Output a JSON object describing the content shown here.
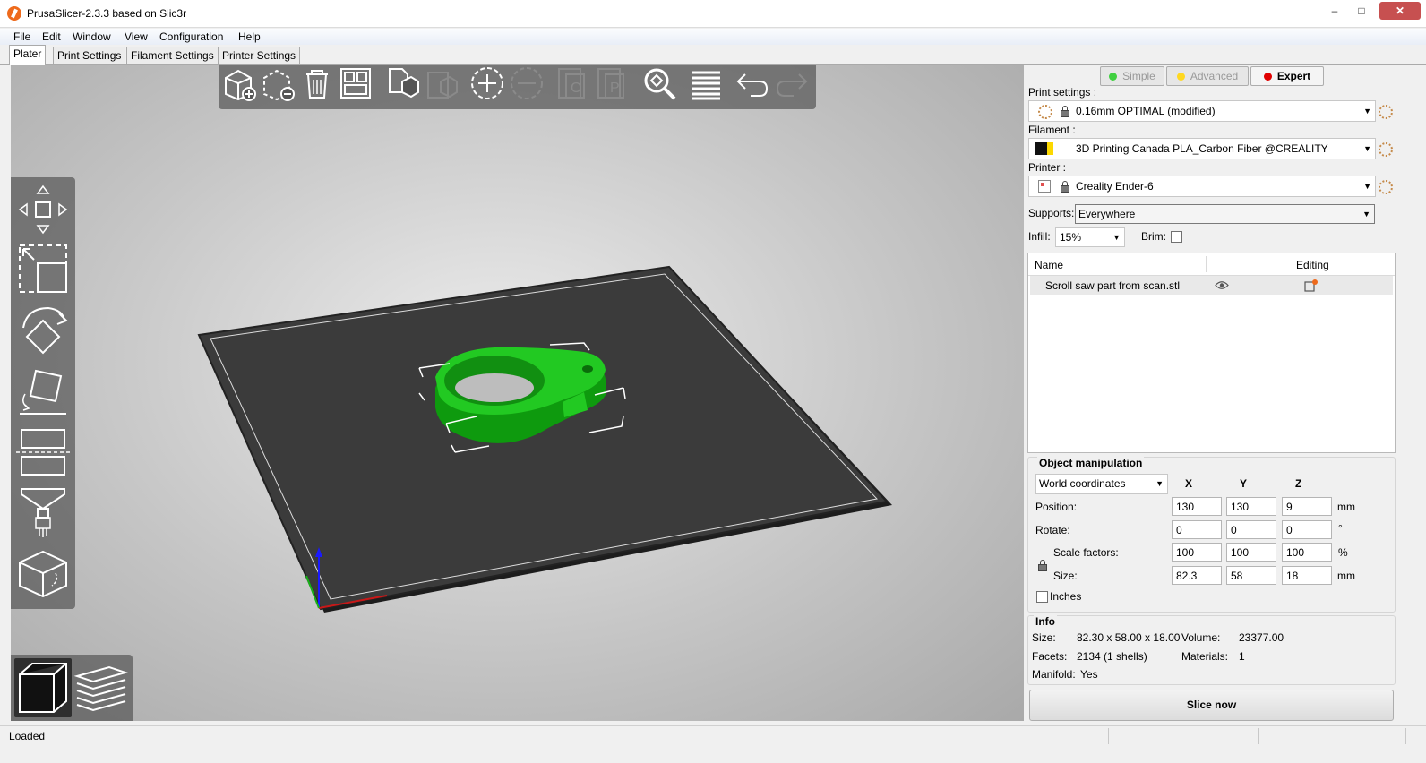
{
  "window": {
    "title": "PrusaSlicer-2.3.3 based on Slic3r",
    "minimize": "–",
    "maximize": "□",
    "close": "✕"
  },
  "menu": [
    "File",
    "Edit",
    "Window",
    "View",
    "Configuration",
    "Help"
  ],
  "tabs": [
    "Plater",
    "Print Settings",
    "Filament Settings",
    "Printer Settings"
  ],
  "active_tab": "Plater",
  "top_toolbar_icons": [
    "add-icon",
    "delete-selected-icon",
    "delete-all-icon",
    "arrange-icon",
    "copy-icon",
    "paste-icon",
    "add-instance-icon",
    "remove-instance-icon",
    "split-objects-icon",
    "split-parts-icon",
    "search-icon",
    "layer-editing-icon",
    "undo-icon",
    "redo-icon"
  ],
  "left_toolbar_icons": [
    "move-icon",
    "scale-icon",
    "rotate-icon",
    "place-on-face-icon",
    "cut-icon",
    "paint-supports-icon",
    "seam-painting-icon"
  ],
  "view_toolbar_icons": [
    "3d-view-icon",
    "preview-icon"
  ],
  "mode": {
    "simple": "Simple",
    "advanced": "Advanced",
    "expert": "Expert"
  },
  "mode_colors": {
    "simple": "#00b000",
    "advanced": "#fcd800",
    "expert": "#e00000"
  },
  "presets": {
    "print_label": "Print settings :",
    "print_value": "0.16mm OPTIMAL (modified)",
    "filament_label": "Filament :",
    "filament_value": "3D Printing Canada PLA_Carbon Fiber @CREALITY",
    "printer_label": "Printer :",
    "printer_value": "Creality Ender-6"
  },
  "supports": {
    "label": "Supports:",
    "value": "Everywhere"
  },
  "infill": {
    "label": "Infill:",
    "value": "15%"
  },
  "brim": {
    "label": "Brim:",
    "checked": false
  },
  "object_list": {
    "col_name": "Name",
    "col_editing": "Editing",
    "rows": [
      {
        "name": "Scroll saw part from scan.stl"
      }
    ]
  },
  "object_manipulation": {
    "title": "Object manipulation",
    "coord_system": "World coordinates",
    "axes": [
      "X",
      "Y",
      "Z"
    ],
    "position_label": "Position:",
    "position": [
      "130",
      "130",
      "9"
    ],
    "position_unit": "mm",
    "rotate_label": "Rotate:",
    "rotate": [
      "0",
      "0",
      "0"
    ],
    "rotate_unit": "°",
    "scale_label": "Scale factors:",
    "scale": [
      "100",
      "100",
      "100"
    ],
    "scale_unit": "%",
    "size_label": "Size:",
    "size": [
      "82.3",
      "58",
      "18"
    ],
    "size_unit": "mm",
    "inches_label": "Inches"
  },
  "info": {
    "title": "Info",
    "size_label": "Size:",
    "size_value": "82.30 x 58.00 x 18.00",
    "volume_label": "Volume:",
    "volume_value": "23377.00",
    "facets_label": "Facets:",
    "facets_value": "2134 (1 shells)",
    "materials_label": "Materials:",
    "materials_value": "1",
    "manifold_label": "Manifold:",
    "manifold_value": "Yes"
  },
  "slice_button": "Slice now",
  "status": "Loaded",
  "colors": {
    "model": "#18c018",
    "bed": "#3e3e3e",
    "accent": "#ee6a1c"
  }
}
